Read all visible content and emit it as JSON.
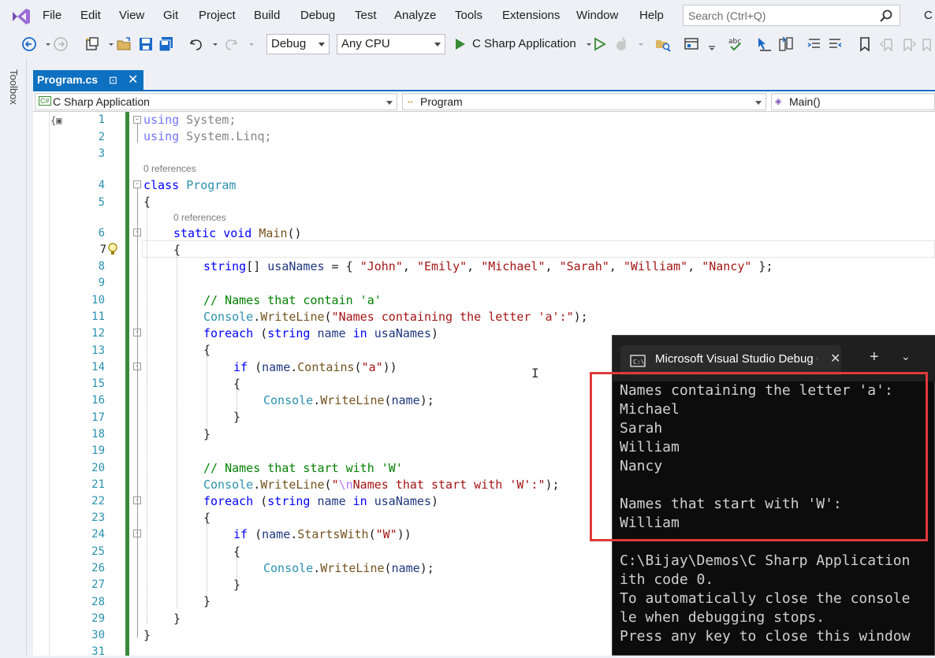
{
  "menubar": {
    "items": [
      "File",
      "Edit",
      "View",
      "Git",
      "Project",
      "Build",
      "Debug",
      "Test",
      "Analyze",
      "Tools",
      "Extensions",
      "Window",
      "Help"
    ],
    "search_placeholder": "Search (Ctrl+Q)",
    "live_share": "C"
  },
  "toolbar": {
    "config": "Debug",
    "platform": "Any CPU",
    "run_target": "C Sharp Application"
  },
  "toolbox": {
    "label": "Toolbox"
  },
  "tab": {
    "file": "Program.cs"
  },
  "navbar": {
    "project": "C Sharp Application",
    "project_icon": "C#",
    "type": "Program",
    "member": "Main()"
  },
  "gutter": {
    "line_numbers": [
      "1",
      "2",
      "3",
      "4",
      "5",
      "6",
      "7",
      "8",
      "9",
      "10",
      "11",
      "12",
      "13",
      "14",
      "15",
      "16",
      "17",
      "18",
      "19",
      "20",
      "21",
      "22",
      "23",
      "24",
      "25",
      "26",
      "27",
      "28",
      "29",
      "30",
      "31"
    ],
    "current_line": "7"
  },
  "code": {
    "l1_kw": "using",
    "l1_rest": " System;",
    "l2_kw": "using",
    "l2_rest": " System.Linq;",
    "ref_class": "0 references",
    "l4_kw": "class",
    "l4_ty": "Program",
    "l5": "{",
    "ref_main": "0 references",
    "l6_kw1": "static",
    "l6_kw2": "void",
    "l6_mt": "Main",
    "l6_rest": "()",
    "l7": "{",
    "l8_kw": "string",
    "l8_a": "[] ",
    "l8_var": "usaNames",
    "l8_b": " = { ",
    "names": [
      "\"John\"",
      "\"Emily\"",
      "\"Michael\"",
      "\"Sarah\"",
      "\"William\"",
      "\"Nancy\""
    ],
    "l8_end": " };",
    "l10_cm": "// Names that contain 'a'",
    "l11_ty": "Console",
    "l11_mt": "WriteLine",
    "l11_str": "\"Names containing the letter 'a':\"",
    "l11_end": ");",
    "l12_kw": "foreach",
    "l12_kw2": "string",
    "l12_v": "name",
    "l12_kw3": "in",
    "l12_v2": "usaNames",
    "l13": "{",
    "l14_kw": "if",
    "l14_v": "name",
    "l14_mt": "Contains",
    "l14_str": "\"a\"",
    "l15": "{",
    "l16_ty": "Console",
    "l16_mt": "WriteLine",
    "l16_v": "name",
    "l17": "}",
    "l18": "}",
    "l20_cm": "// Names that start with 'W'",
    "l21_ty": "Console",
    "l21_mt": "WriteLine",
    "l21_q": "\"",
    "l21_esc": "\\n",
    "l21_str": "Names that start with 'W':\"",
    "l21_end": ");",
    "l22_kw": "foreach",
    "l22_kw2": "string",
    "l22_v": "name",
    "l22_kw3": "in",
    "l22_v2": "usaNames",
    "l23": "{",
    "l24_kw": "if",
    "l24_v": "name",
    "l24_mt": "StartsWith",
    "l24_str": "\"W\"",
    "l25": "{",
    "l26_ty": "Console",
    "l26_mt": "WriteLine",
    "l26_v": "name",
    "l27": "}",
    "l28": "}",
    "l29": "}",
    "l30": "}"
  },
  "console": {
    "title": "Microsoft Visual Studio Debug Console",
    "lines": [
      "Names containing the letter 'a':",
      "Michael",
      "Sarah",
      "William",
      "Nancy",
      "",
      "Names that start with 'W':",
      "William",
      "",
      "C:\\Bijay\\Demos\\C Sharp Application",
      "ith code 0.",
      "To automatically close the console",
      "le when debugging stops.",
      "Press any key to close this window"
    ]
  },
  "colors": {
    "accent": "#0e70c0",
    "keyword": "#0000ff",
    "type": "#2b91af",
    "string": "#a31515",
    "comment": "#008000",
    "highlight_box": "#e03a3a",
    "change_bar": "#3a8a3a"
  }
}
